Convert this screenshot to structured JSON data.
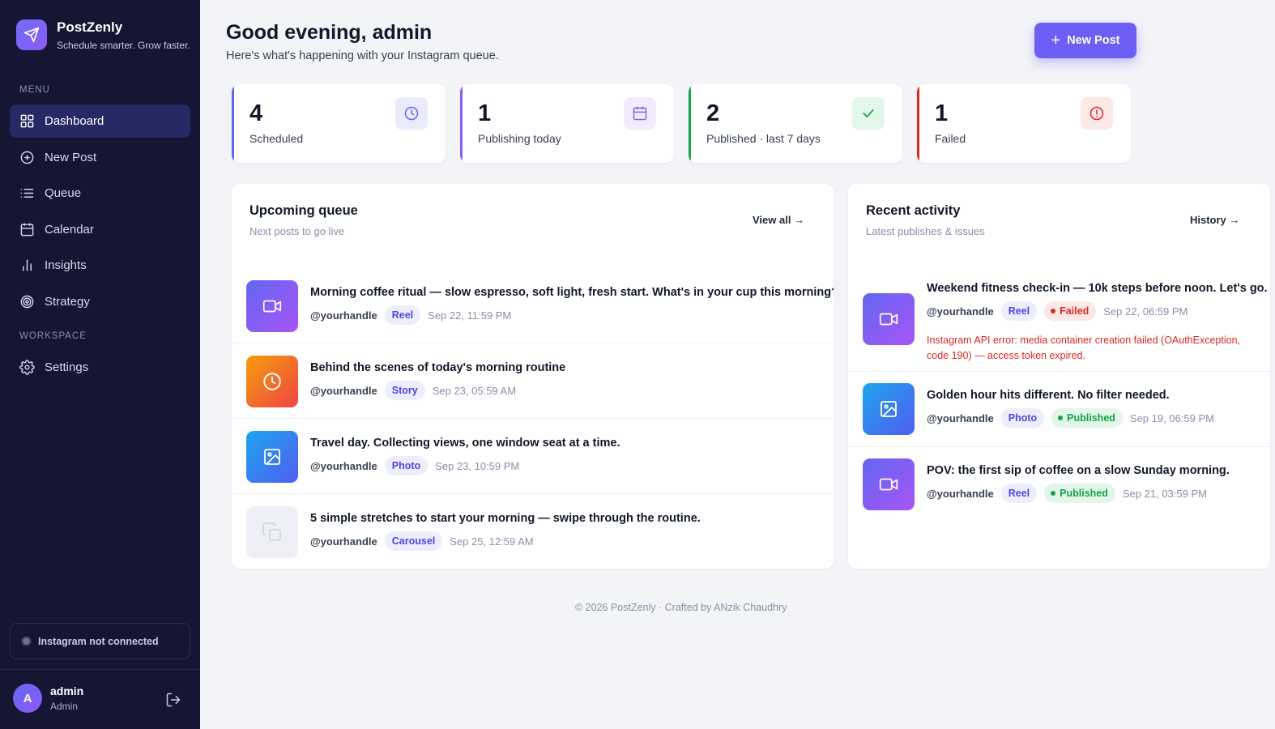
{
  "app": {
    "name": "PostZenly",
    "tagline": "Schedule smarter. Grow faster."
  },
  "sidebar": {
    "menu_label": "MENU",
    "menu_items": [
      {
        "label": "Dashboard",
        "icon": "grid-icon",
        "active": true
      },
      {
        "label": "New Post",
        "icon": "plus-circle-icon"
      },
      {
        "label": "Queue",
        "icon": "list-icon"
      },
      {
        "label": "Calendar",
        "icon": "calendar-icon"
      },
      {
        "label": "Insights",
        "icon": "bar-chart-icon"
      },
      {
        "label": "Strategy",
        "icon": "target-icon"
      }
    ],
    "workspace_label": "WORKSPACE",
    "workspace_items": [
      {
        "label": "Settings",
        "icon": "gear-icon"
      }
    ],
    "instagram_status": "Instagram not connected",
    "user": {
      "initial": "A",
      "name": "admin",
      "role": "Admin"
    }
  },
  "header": {
    "greeting": "Good evening, admin",
    "subtitle": "Here's what's happening with your Instagram queue.",
    "new_post_label": "New Post"
  },
  "stats": [
    {
      "value": "4",
      "label": "Scheduled",
      "accent": "#6366f1",
      "icon": "clock-icon"
    },
    {
      "value": "1",
      "label": "Publishing today",
      "accent": "#8b5cf6",
      "icon": "calendar-icon"
    },
    {
      "value": "2",
      "label": "Published · last 7 days",
      "accent": "#16a34a",
      "icon": "check-icon"
    },
    {
      "value": "1",
      "label": "Failed",
      "accent": "#dc2626",
      "icon": "alert-circle-icon"
    }
  ],
  "queue": {
    "title": "Upcoming queue",
    "subtitle": "Next posts to go live",
    "link": "View all →",
    "items": [
      {
        "title": "Morning coffee ritual — slow espresso, soft light, fresh start. What's in your cup this morning?",
        "handle": "@yourhandle",
        "type": "Reel",
        "time": "Sep 22, 11:59 PM"
      },
      {
        "title": "Behind the scenes of today's morning routine",
        "handle": "@yourhandle",
        "type": "Story",
        "time": "Sep 23, 05:59 AM"
      },
      {
        "title": "Travel day. Collecting views, one window seat at a time.",
        "handle": "@yourhandle",
        "type": "Photo",
        "time": "Sep 23, 10:59 PM"
      },
      {
        "title": "5 simple stretches to start your morning — swipe through the routine.",
        "handle": "@yourhandle",
        "type": "Carousel",
        "time": "Sep 25, 12:59 AM"
      }
    ]
  },
  "activity": {
    "title": "Recent activity",
    "subtitle": "Latest publishes & issues",
    "link": "History →",
    "items": [
      {
        "title": "Weekend fitness check-in — 10k steps before noon. Let's go.",
        "handle": "@yourhandle",
        "type": "Reel",
        "status": "Failed",
        "time": "Sep 22, 06:59 PM",
        "error": "Instagram API error: media container creation failed (OAuthException, code 190) — access token expired."
      },
      {
        "title": "Golden hour hits different. No filter needed.",
        "handle": "@yourhandle",
        "type": "Photo",
        "status": "Published",
        "time": "Sep 19, 06:59 PM"
      },
      {
        "title": "POV: the first sip of coffee on a slow Sunday morning.",
        "handle": "@yourhandle",
        "type": "Reel",
        "status": "Published",
        "time": "Sep 21, 03:59 PM"
      }
    ]
  },
  "footer": {
    "text": "© 2026 PostZenly · Crafted by ANzik Chaudhry"
  }
}
